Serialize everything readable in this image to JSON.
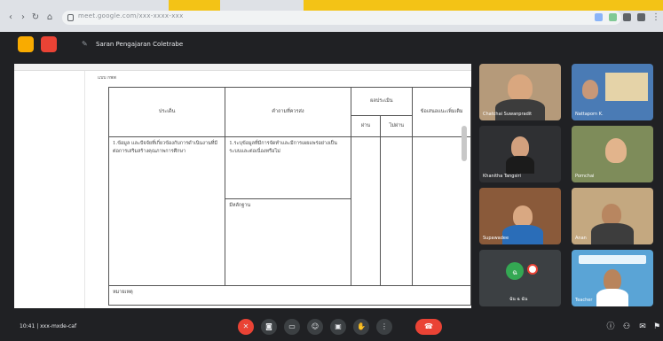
{
  "browser": {
    "url": "meet.google.com/xxx-xxxx-xxx",
    "accent": "#f3c316"
  },
  "meet": {
    "title": "Saran Pengajaran Coletrabe"
  },
  "document": {
    "tag": "แบบ กพพ",
    "headers": {
      "col1": "ประเด็น",
      "col2": "คำถามที่ควรส่ง",
      "col3": "ผลประเมิน",
      "col3a": "ผ่าน",
      "col3b": "ไม่ผ่าน",
      "col4": "ข้อเสนอแนะเพิ่มเติม"
    },
    "row1": {
      "issue": "1.ข้อมูล และปัจจัยที่เกี่ยวข้องกับการดำเนินงานที่มีต่อการเสริมสร้างคุณภาพการศึกษา",
      "q1": "1.ระบุข้อมูลที่มีการจัดทำและมีการเผยแพร่อย่างเป็นระบบและต่อเนื่องหรือไม่",
      "q2": "มีหลักฐาน"
    },
    "footer_label": "หมายเหตุ"
  },
  "participants": [
    {
      "name": "Chatchai Suwanpradit"
    },
    {
      "name": "Nattaporn K."
    },
    {
      "name": "Khanitha Tangsiri"
    },
    {
      "name": "Pornchai"
    },
    {
      "name": "Supawadee"
    },
    {
      "name": "Anan"
    },
    {
      "name": "ฉัน ฉ ฉัน",
      "initial": "ฉ"
    },
    {
      "name": "Teacher"
    }
  ],
  "bottom_bar": {
    "time": "10:41 | xxx-mxde-caf"
  }
}
